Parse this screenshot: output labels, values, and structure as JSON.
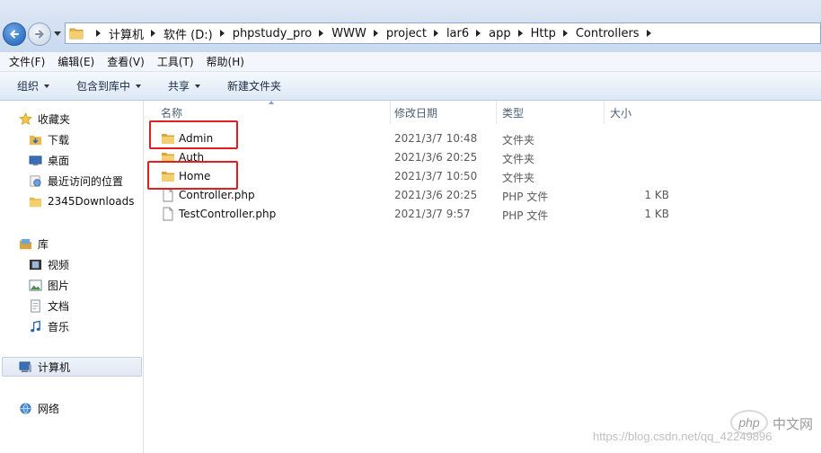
{
  "address": {
    "crumbs": [
      "计算机",
      "软件 (D:)",
      "phpstudy_pro",
      "WWW",
      "project",
      "lar6",
      "app",
      "Http",
      "Controllers"
    ]
  },
  "menu": [
    "文件(F)",
    "编辑(E)",
    "查看(V)",
    "工具(T)",
    "帮助(H)"
  ],
  "toolbar": {
    "organize": "组织",
    "include_library": "包含到库中",
    "share": "共享",
    "new_folder": "新建文件夹"
  },
  "nav": {
    "favorites": "收藏夹",
    "downloads": "下载",
    "desktop": "桌面",
    "recent": "最近访问的位置",
    "downloads2345": "2345Downloads",
    "libraries": "库",
    "videos": "视频",
    "pictures": "图片",
    "documents": "文档",
    "music": "音乐",
    "computer": "计算机",
    "network": "网络"
  },
  "columns": {
    "name": "名称",
    "date": "修改日期",
    "type": "类型",
    "size": "大小"
  },
  "files": [
    {
      "name": "Admin",
      "date": "2021/3/7 10:48",
      "type": "文件夹",
      "size": "",
      "kind": "folder"
    },
    {
      "name": "Auth",
      "date": "2021/3/6 20:25",
      "type": "文件夹",
      "size": "",
      "kind": "folder"
    },
    {
      "name": "Home",
      "date": "2021/3/7 10:50",
      "type": "文件夹",
      "size": "",
      "kind": "folder"
    },
    {
      "name": "Controller.php",
      "date": "2021/3/6 20:25",
      "type": "PHP 文件",
      "size": "1 KB",
      "kind": "file"
    },
    {
      "name": "TestController.php",
      "date": "2021/3/7 9:57",
      "type": "PHP 文件",
      "size": "1 KB",
      "kind": "file"
    }
  ],
  "watermark": {
    "logo": "php",
    "cn": "中文网",
    "url": "https://blog.csdn.net/qq_42249896"
  },
  "colors": {
    "highlight": "#e02020",
    "folder": "#e8b84a"
  }
}
